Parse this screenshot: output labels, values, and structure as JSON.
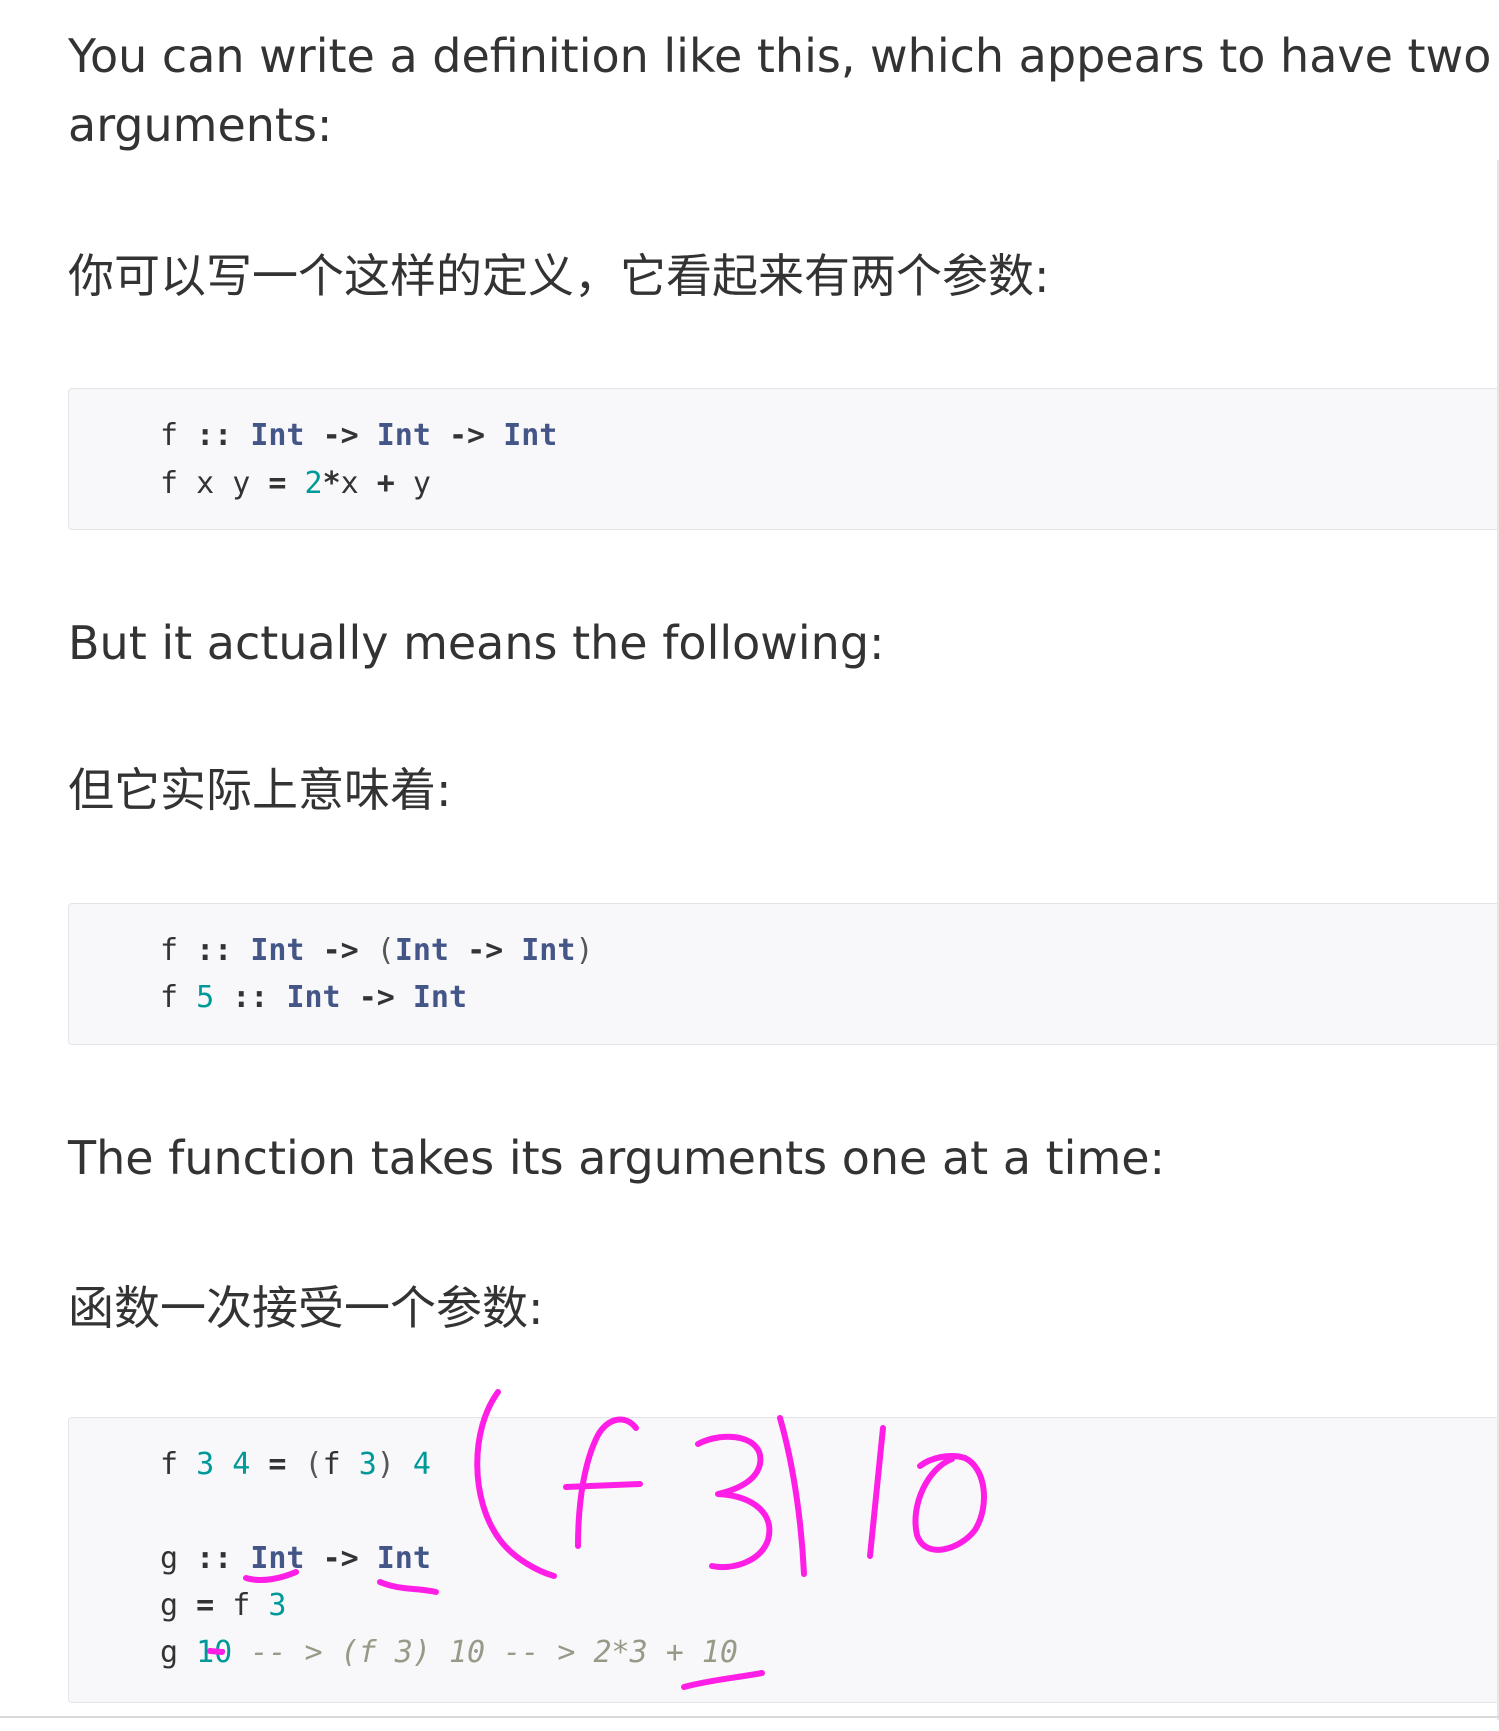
{
  "doc": {
    "para1": "You can write a definition like this, which appears to have two arguments:",
    "para1_line1": "You can write a definition like this, which appears to have two",
    "para1_line2": "arguments:",
    "para2": "你可以写一个这样的定义，它看起来有两个参数:",
    "para3": "But it actually means the following:",
    "para4": "但它实际上意味着:",
    "para5": "The function takes its arguments one at a time:",
    "para6": "函数一次接受一个参数:"
  },
  "code_blocks": [
    {
      "lines": [
        [
          {
            "t": "f",
            "k": "id"
          },
          {
            "t": " ",
            "k": "id"
          },
          {
            "t": "::",
            "k": "op"
          },
          {
            "t": " ",
            "k": "id"
          },
          {
            "t": "Int",
            "k": "type"
          },
          {
            "t": " ",
            "k": "id"
          },
          {
            "t": "->",
            "k": "op"
          },
          {
            "t": " ",
            "k": "id"
          },
          {
            "t": "Int",
            "k": "type"
          },
          {
            "t": " ",
            "k": "id"
          },
          {
            "t": "->",
            "k": "op"
          },
          {
            "t": " ",
            "k": "id"
          },
          {
            "t": "Int",
            "k": "type"
          }
        ],
        [
          {
            "t": "f",
            "k": "id"
          },
          {
            "t": " ",
            "k": "id"
          },
          {
            "t": "x",
            "k": "id"
          },
          {
            "t": " ",
            "k": "id"
          },
          {
            "t": "y",
            "k": "id"
          },
          {
            "t": " ",
            "k": "id"
          },
          {
            "t": "=",
            "k": "op"
          },
          {
            "t": " ",
            "k": "id"
          },
          {
            "t": "2",
            "k": "num"
          },
          {
            "t": "*",
            "k": "op"
          },
          {
            "t": "x",
            "k": "id"
          },
          {
            "t": " ",
            "k": "id"
          },
          {
            "t": "+",
            "k": "op"
          },
          {
            "t": " ",
            "k": "id"
          },
          {
            "t": "y",
            "k": "id"
          }
        ]
      ]
    },
    {
      "lines": [
        [
          {
            "t": "f",
            "k": "id"
          },
          {
            "t": " ",
            "k": "id"
          },
          {
            "t": "::",
            "k": "op"
          },
          {
            "t": " ",
            "k": "id"
          },
          {
            "t": "Int",
            "k": "type"
          },
          {
            "t": " ",
            "k": "id"
          },
          {
            "t": "->",
            "k": "op"
          },
          {
            "t": " ",
            "k": "id"
          },
          {
            "t": "(",
            "k": "punct"
          },
          {
            "t": "Int",
            "k": "type"
          },
          {
            "t": " ",
            "k": "id"
          },
          {
            "t": "->",
            "k": "op"
          },
          {
            "t": " ",
            "k": "id"
          },
          {
            "t": "Int",
            "k": "type"
          },
          {
            "t": ")",
            "k": "punct"
          }
        ],
        [
          {
            "t": "f",
            "k": "id"
          },
          {
            "t": " ",
            "k": "id"
          },
          {
            "t": "5",
            "k": "num"
          },
          {
            "t": " ",
            "k": "id"
          },
          {
            "t": "::",
            "k": "op"
          },
          {
            "t": " ",
            "k": "id"
          },
          {
            "t": "Int",
            "k": "type"
          },
          {
            "t": " ",
            "k": "id"
          },
          {
            "t": "->",
            "k": "op"
          },
          {
            "t": " ",
            "k": "id"
          },
          {
            "t": "Int",
            "k": "type"
          }
        ]
      ]
    },
    {
      "lines": [
        [
          {
            "t": "f",
            "k": "id"
          },
          {
            "t": " ",
            "k": "id"
          },
          {
            "t": "3",
            "k": "num"
          },
          {
            "t": " ",
            "k": "id"
          },
          {
            "t": "4",
            "k": "num"
          },
          {
            "t": " ",
            "k": "id"
          },
          {
            "t": "=",
            "k": "op"
          },
          {
            "t": " ",
            "k": "id"
          },
          {
            "t": "(",
            "k": "punct"
          },
          {
            "t": "f",
            "k": "id"
          },
          {
            "t": " ",
            "k": "id"
          },
          {
            "t": "3",
            "k": "num"
          },
          {
            "t": ")",
            "k": "punct"
          },
          {
            "t": " ",
            "k": "id"
          },
          {
            "t": "4",
            "k": "num"
          }
        ],
        [],
        [
          {
            "t": "g",
            "k": "id"
          },
          {
            "t": " ",
            "k": "id"
          },
          {
            "t": "::",
            "k": "op"
          },
          {
            "t": " ",
            "k": "id"
          },
          {
            "t": "Int",
            "k": "type"
          },
          {
            "t": " ",
            "k": "id"
          },
          {
            "t": "->",
            "k": "op"
          },
          {
            "t": " ",
            "k": "id"
          },
          {
            "t": "Int",
            "k": "type"
          }
        ],
        [
          {
            "t": "g",
            "k": "id"
          },
          {
            "t": " ",
            "k": "id"
          },
          {
            "t": "=",
            "k": "op"
          },
          {
            "t": " ",
            "k": "id"
          },
          {
            "t": "f",
            "k": "id"
          },
          {
            "t": " ",
            "k": "id"
          },
          {
            "t": "3",
            "k": "num"
          }
        ],
        [
          {
            "t": "g",
            "k": "id"
          },
          {
            "t": " ",
            "k": "id"
          },
          {
            "t": "10",
            "k": "num"
          },
          {
            "t": " ",
            "k": "id"
          },
          {
            "t": "-- > (f 3) 10 -- > 2*3 + 10",
            "k": "comment"
          }
        ]
      ]
    }
  ],
  "handwriting": {
    "color": "#ff1ee6",
    "text": "(f 3) 10"
  }
}
